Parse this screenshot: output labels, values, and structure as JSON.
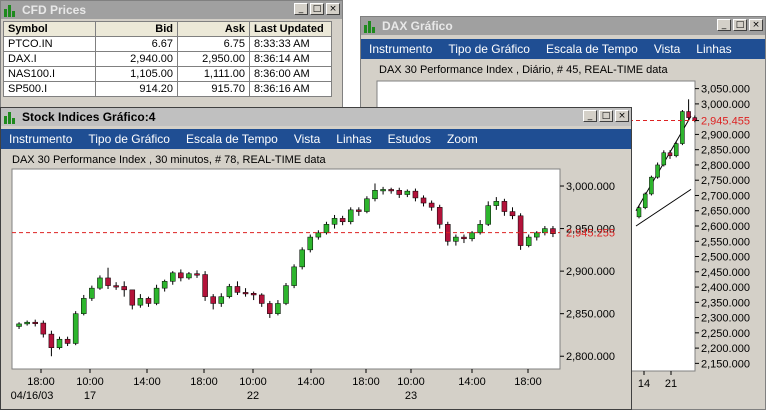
{
  "cfd": {
    "title": "CFD Prices",
    "headers": [
      "Symbol",
      "Bid",
      "Ask",
      "Last Updated"
    ],
    "rows": [
      [
        "PTCO.IN",
        "6.67",
        "6.75",
        "8:33:33 AM"
      ],
      [
        "DAX.I",
        "2,940.00",
        "2,950.00",
        "8:36:14 AM"
      ],
      [
        "NAS100.I",
        "1,105.00",
        "1,111.00",
        "8:36:00 AM"
      ],
      [
        "SP500.I",
        "914.20",
        "915.70",
        "8:36:16 AM"
      ]
    ]
  },
  "dax_window": {
    "title": "DAX Gráfico",
    "menu": [
      "Instrumento",
      "Tipo de Gráfico",
      "Escala de Tempo",
      "Vista",
      "Linhas"
    ],
    "subtitle": "DAX 30 Performance Index , Diário, # 45, REAL-TIME data",
    "y_ticks": [
      "3,050.000",
      "3,000.000",
      "2,945.455",
      "2,900.000",
      "2,850.000",
      "2,800.000",
      "2,750.000",
      "2,700.000",
      "2,650.000",
      "2,600.000",
      "2,550.000",
      "2,500.000",
      "2,450.000",
      "2,400.000",
      "2,350.000",
      "2,300.000",
      "2,250.000",
      "2,200.000",
      "2,150.000"
    ],
    "x_ticks": [
      "14",
      "21"
    ],
    "current_price": "2,945.455"
  },
  "stock_window": {
    "title": "Stock Indices Gráfico:4",
    "menu": [
      "Instrumento",
      "Tipo de Gráfico",
      "Escala de Tempo",
      "Vista",
      "Linhas",
      "Estudos",
      "Zoom"
    ],
    "subtitle": "DAX 30 Performance Index , 30 minutos, # 78, REAL-TIME data",
    "y_ticks": [
      "3,000.000",
      "2,950.000",
      "2,900.000",
      "2,850.000",
      "2,800.000"
    ],
    "current_price": "2,945.255",
    "x_ticks": [
      {
        "time": "18:00",
        "date": "04/16/03"
      },
      {
        "time": "10:00",
        "date": "17"
      },
      {
        "time": "14:00",
        "date": ""
      },
      {
        "time": "18:00",
        "date": ""
      },
      {
        "time": "10:00",
        "date": "22"
      },
      {
        "time": "14:00",
        "date": ""
      },
      {
        "time": "18:00",
        "date": ""
      },
      {
        "time": "10:00",
        "date": "23"
      },
      {
        "time": "14:00",
        "date": ""
      },
      {
        "time": "18:00",
        "date": ""
      }
    ]
  },
  "chart_data": [
    {
      "type": "candlestick",
      "title": "DAX 30 Performance Index , 30 minutos, # 78, REAL-TIME data",
      "ylim": [
        2785,
        3020
      ],
      "reference_line": 2945.255,
      "candles": [
        [
          2835,
          2838,
          2832,
          2840
        ],
        [
          2838,
          2840,
          2836,
          2842
        ],
        [
          2840,
          2839,
          2835,
          2843
        ],
        [
          2839,
          2826,
          2822,
          2842
        ],
        [
          2826,
          2810,
          2800,
          2830
        ],
        [
          2810,
          2820,
          2808,
          2823
        ],
        [
          2820,
          2815,
          2812,
          2823
        ],
        [
          2815,
          2850,
          2813,
          2853
        ],
        [
          2850,
          2868,
          2848,
          2872
        ],
        [
          2868,
          2880,
          2865,
          2883
        ],
        [
          2880,
          2892,
          2878,
          2895
        ],
        [
          2892,
          2883,
          2879,
          2904
        ],
        [
          2883,
          2882,
          2878,
          2887
        ],
        [
          2882,
          2878,
          2870,
          2888
        ],
        [
          2878,
          2860,
          2855,
          2875
        ],
        [
          2860,
          2868,
          2857,
          2873
        ],
        [
          2868,
          2862,
          2858,
          2870
        ],
        [
          2862,
          2880,
          2860,
          2884
        ],
        [
          2880,
          2888,
          2876,
          2890
        ],
        [
          2888,
          2898,
          2884,
          2900
        ],
        [
          2898,
          2892,
          2888,
          2902
        ],
        [
          2892,
          2897,
          2890,
          2899
        ],
        [
          2897,
          2896,
          2892,
          2901
        ],
        [
          2896,
          2870,
          2865,
          2900
        ],
        [
          2870,
          2862,
          2855,
          2873
        ],
        [
          2862,
          2870,
          2858,
          2874
        ],
        [
          2870,
          2882,
          2868,
          2885
        ],
        [
          2882,
          2875,
          2872,
          2888
        ],
        [
          2875,
          2874,
          2870,
          2880
        ],
        [
          2874,
          2872,
          2866,
          2876
        ],
        [
          2872,
          2862,
          2858,
          2874
        ],
        [
          2862,
          2850,
          2845,
          2865
        ],
        [
          2850,
          2862,
          2848,
          2866
        ],
        [
          2862,
          2883,
          2860,
          2886
        ],
        [
          2883,
          2905,
          2880,
          2908
        ],
        [
          2905,
          2925,
          2902,
          2928
        ],
        [
          2925,
          2940,
          2922,
          2943
        ],
        [
          2940,
          2945,
          2937,
          2948
        ],
        [
          2945,
          2955,
          2943,
          2958
        ],
        [
          2955,
          2962,
          2950,
          2966
        ],
        [
          2962,
          2958,
          2954,
          2965
        ],
        [
          2958,
          2972,
          2955,
          2975
        ],
        [
          2972,
          2970,
          2965,
          2975
        ],
        [
          2970,
          2985,
          2968,
          2988
        ],
        [
          2985,
          2995,
          2982,
          3003
        ],
        [
          2995,
          2996,
          2990,
          2999
        ],
        [
          2996,
          2995,
          2991,
          2998
        ],
        [
          2995,
          2990,
          2986,
          2998
        ],
        [
          2990,
          2994,
          2987,
          2996
        ],
        [
          2994,
          2986,
          2982,
          2997
        ],
        [
          2986,
          2980,
          2976,
          2989
        ],
        [
          2980,
          2975,
          2971,
          2983
        ],
        [
          2975,
          2955,
          2950,
          2978
        ],
        [
          2955,
          2935,
          2930,
          2958
        ],
        [
          2935,
          2940,
          2930,
          2943
        ],
        [
          2940,
          2938,
          2933,
          2943
        ],
        [
          2938,
          2945,
          2935,
          2947
        ],
        [
          2945,
          2955,
          2943,
          2960
        ],
        [
          2955,
          2977,
          2953,
          2982
        ],
        [
          2977,
          2982,
          2972,
          2987
        ],
        [
          2982,
          2970,
          2965,
          2985
        ],
        [
          2970,
          2965,
          2961,
          2975
        ],
        [
          2965,
          2930,
          2925,
          2968
        ],
        [
          2930,
          2940,
          2928,
          2943
        ],
        [
          2940,
          2945,
          2936,
          2947
        ],
        [
          2945,
          2950,
          2942,
          2953
        ],
        [
          2950,
          2944,
          2940,
          2953
        ]
      ]
    },
    {
      "type": "candlestick",
      "title": "DAX 30 Performance Index , Diário, # 45, REAL-TIME data",
      "ylim": [
        2125,
        3075
      ],
      "reference_line": 2945.455,
      "candles": [
        [
          2630,
          2660,
          2625,
          2668
        ],
        [
          2660,
          2705,
          2655,
          2710
        ],
        [
          2705,
          2760,
          2700,
          2765
        ],
        [
          2760,
          2800,
          2755,
          2808
        ],
        [
          2800,
          2840,
          2795,
          2848
        ],
        [
          2840,
          2830,
          2820,
          2848
        ],
        [
          2830,
          2870,
          2825,
          2875
        ],
        [
          2870,
          2975,
          2865,
          2980
        ],
        [
          2975,
          2955,
          2945,
          3015
        ],
        [
          2955,
          2945,
          2940,
          2962
        ]
      ]
    }
  ]
}
